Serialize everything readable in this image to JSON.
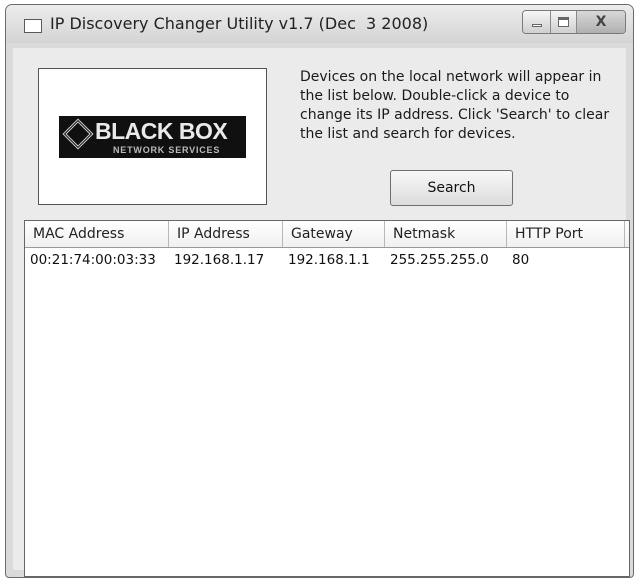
{
  "window": {
    "title": "IP Discovery Changer Utility v1.7 (Dec  3 2008)",
    "controls": {
      "close_glyph": "X"
    }
  },
  "logo": {
    "brand": "BLACK BOX",
    "subtitle": "NETWORK SERVICES"
  },
  "instructions": "Devices on the local network will appear in the list below. Double-click a device to change its IP address. Click 'Search' to clear the list and search for devices.",
  "search_button": {
    "label": "Search"
  },
  "device_list": {
    "columns": [
      "MAC Address",
      "IP Address",
      "Gateway",
      "Netmask",
      "HTTP Port"
    ],
    "rows": [
      [
        "00:21:74:00:03:33",
        "192.168.1.17",
        "192.168.1.1",
        "255.255.255.0",
        "80"
      ]
    ]
  }
}
